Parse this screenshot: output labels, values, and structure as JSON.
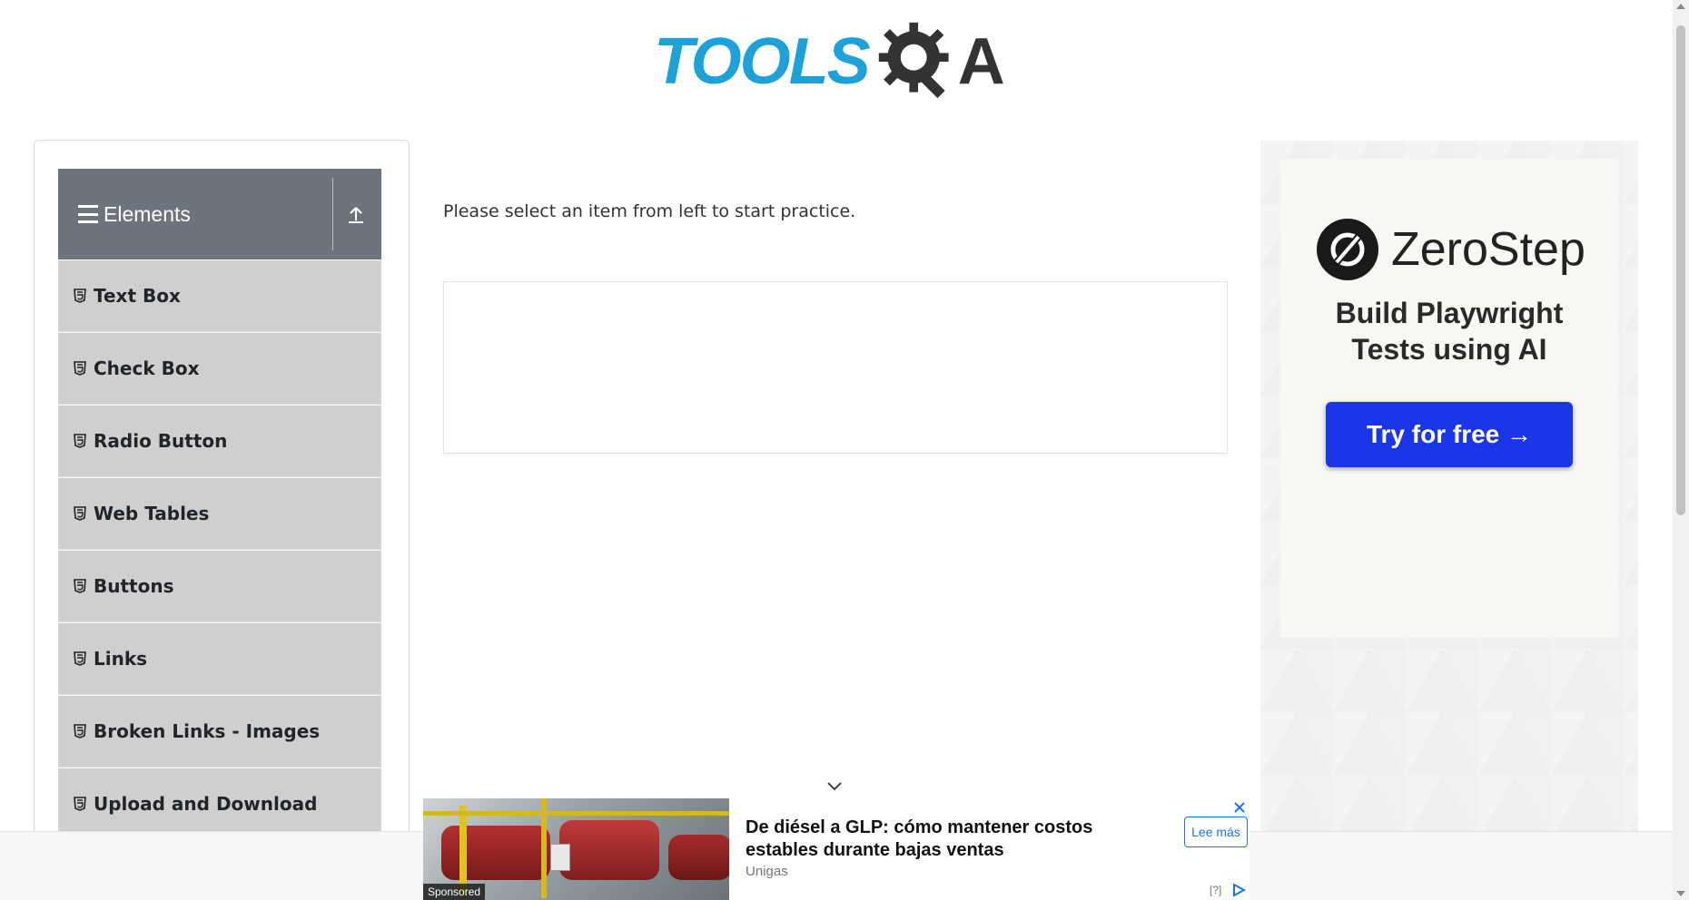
{
  "header": {
    "logo_part1": "TOOLS",
    "logo_part2": "A"
  },
  "sidebar": {
    "group_title": "Elements",
    "items": [
      {
        "label": "Text Box",
        "icon": "html5-icon"
      },
      {
        "label": "Check Box",
        "icon": "html5-icon"
      },
      {
        "label": "Radio Button",
        "icon": "html5-icon"
      },
      {
        "label": "Web Tables",
        "icon": "html5-icon"
      },
      {
        "label": "Buttons",
        "icon": "html5-icon"
      },
      {
        "label": "Links",
        "icon": "html5-icon"
      },
      {
        "label": "Broken Links - Images",
        "icon": "html5-icon"
      },
      {
        "label": "Upload and Download",
        "icon": "html5-icon"
      }
    ]
  },
  "main": {
    "instruction": "Please select an item from left to start practice."
  },
  "right_ad": {
    "brand": "ZeroStep",
    "tagline_line1": "Build Playwright",
    "tagline_line2": "Tests using AI",
    "cta": "Try for free →",
    "cta_color": "#1a36e6"
  },
  "bottom_ad": {
    "sponsored_label": "Sponsored",
    "title": "De diésel a GLP: cómo mantener costos estables durante bajas ventas",
    "source": "Unigas",
    "button": "Lee más",
    "info": "[?]"
  },
  "colors": {
    "accent": "#1da1d9",
    "sidebar_header": "#6c757d",
    "sidebar_item": "#cfcfcf"
  }
}
